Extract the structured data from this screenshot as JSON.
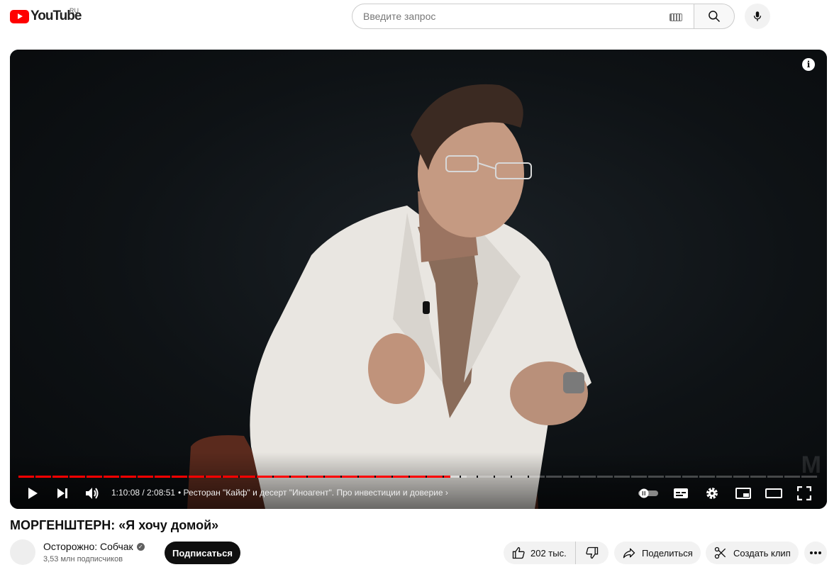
{
  "header": {
    "logo_text": "YouTube",
    "region": "RU",
    "search_placeholder": "Введите запрос",
    "icons": [
      "keyboard-icon",
      "search-icon",
      "mic-icon"
    ]
  },
  "player": {
    "progress": 0.54,
    "buffered": 0.56,
    "time": "1:10:08 / 2:08:51",
    "chapter": "Ресторан \"Кайф\" и десерт \"Иноагент\". Про инвестиции и доверие",
    "info_icon": "i",
    "watermark": "M",
    "icons": [
      "play-icon",
      "next-icon",
      "volume-icon",
      "autoplay-toggle-icon",
      "subtitles-icon",
      "settings-icon",
      "miniplayer-icon",
      "theater-icon",
      "fullscreen-icon"
    ]
  },
  "video": {
    "title": "МОРГЕНШТЕРН: «Я хочу домой»",
    "channel": "Осторожно: Собчак",
    "subscribers": "3,53 млн подписчиков",
    "subscribe_label": "Подписаться",
    "likes": "202 тыс.",
    "share_label": "Поделиться",
    "clip_label": "Создать клип"
  },
  "colors": {
    "accent": "#ff0000",
    "button_bg": "#f2f2f2",
    "subscribe_bg": "#0f0f0f"
  }
}
